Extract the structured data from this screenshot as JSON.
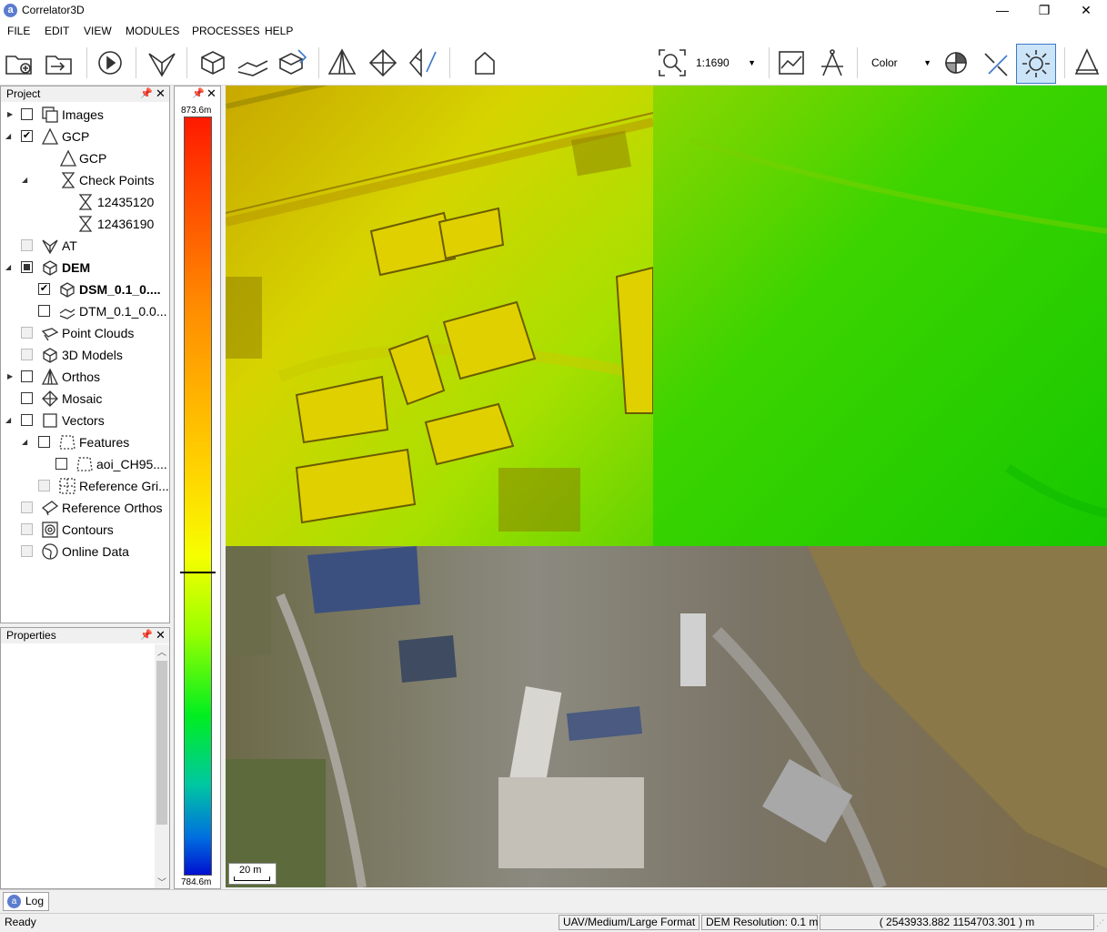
{
  "app": {
    "title": "Correlator3D",
    "logo_letter": "a"
  },
  "window_controls": {
    "minimize": "—",
    "restore": "❐",
    "close": "✕"
  },
  "menu": [
    "FILE",
    "EDIT",
    "VIEW",
    "MODULES",
    "PROCESSES",
    "HELP"
  ],
  "toolbar": {
    "scale_value": "1:1690",
    "display_mode": "Color",
    "icons": [
      "new-project-icon",
      "import-icon",
      "run-icon",
      "aerial-triangulation-icon",
      "dem-icon",
      "terrain-icon",
      "edit-dem-icon",
      "gcp-icon",
      "add-point-icon",
      "edit-point-icon",
      "home-icon",
      "zoom-icon",
      "profile-icon",
      "compass-icon",
      "histogram-icon",
      "measure-icon",
      "sun-icon",
      "triangle-icon"
    ]
  },
  "project_panel": {
    "title": "Project",
    "items": [
      {
        "label": "Images",
        "bold": false
      },
      {
        "label": "GCP",
        "bold": false
      },
      {
        "label": "GCP",
        "bold": false
      },
      {
        "label": "Check Points",
        "bold": false
      },
      {
        "label": "12435120",
        "bold": false
      },
      {
        "label": "12436190",
        "bold": false
      },
      {
        "label": "AT",
        "bold": false
      },
      {
        "label": "DEM",
        "bold": true
      },
      {
        "label": "DSM_0.1_0....",
        "bold": true
      },
      {
        "label": "DTM_0.1_0.0...",
        "bold": false
      },
      {
        "label": "Point Clouds",
        "bold": false
      },
      {
        "label": "3D Models",
        "bold": false
      },
      {
        "label": "Orthos",
        "bold": false
      },
      {
        "label": "Mosaic",
        "bold": false
      },
      {
        "label": "Vectors",
        "bold": false
      },
      {
        "label": "Features",
        "bold": false
      },
      {
        "label": "aoi_CH95....",
        "bold": false
      },
      {
        "label": "Reference Gri...",
        "bold": false
      },
      {
        "label": "Reference Orthos",
        "bold": false
      },
      {
        "label": "Contours",
        "bold": false
      },
      {
        "label": "Online Data",
        "bold": false
      }
    ]
  },
  "properties_panel": {
    "title": "Properties"
  },
  "legend": {
    "max": "873.6m",
    "min": "784.6m",
    "marker_fraction": 0.6
  },
  "map": {
    "scale_bar": "20 m"
  },
  "log_tab": "Log",
  "status": {
    "ready": "Ready",
    "format": "UAV/Medium/Large Format",
    "resolution": "DEM Resolution: 0.1 m",
    "coords": "( 2543933.882 1154703.301 ) m"
  },
  "colors": {
    "accent": "#3c78c8",
    "selected_toolbar": "#cce4f7"
  }
}
